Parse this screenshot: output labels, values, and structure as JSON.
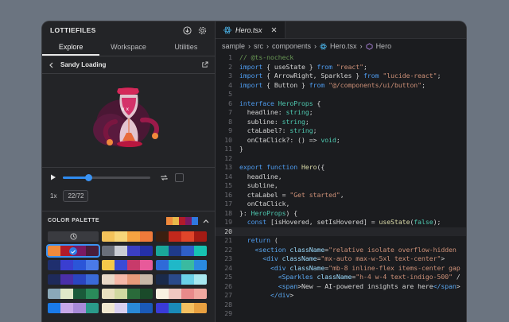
{
  "left_panel": {
    "title": "LOTTIEFILES",
    "tabs": [
      {
        "label": "Explore"
      },
      {
        "label": "Workspace"
      },
      {
        "label": "Utilities"
      }
    ],
    "animation_name": "Sandy Loading",
    "player": {
      "progress": 0.29,
      "speed": "1x",
      "frame": "22/72"
    },
    "palette": {
      "title": "COLOR PALETTE",
      "current": [
        "#f08a3c",
        "#e8b94a",
        "#b11b2a",
        "#7a1a63",
        "#2f78e0"
      ]
    }
  },
  "editor": {
    "tab": {
      "file": "Hero.tsx"
    },
    "breadcrumb": [
      "sample",
      "src",
      "components",
      "Hero.tsx",
      "Hero"
    ],
    "current_line": 20,
    "lines": [
      {
        "n": "1",
        "t": "// @ts-nocheck"
      },
      {
        "n": "2",
        "t": "import { useState } from \"react\";"
      },
      {
        "n": "3",
        "t": "import { ArrowRight, Sparkles } from \"lucide-react\";"
      },
      {
        "n": "4",
        "t": "import { Button } from \"@/components/ui/button\";"
      },
      {
        "n": "5",
        "t": ""
      },
      {
        "n": "6",
        "t": "interface HeroProps {"
      },
      {
        "n": "7",
        "t": "  headline: string;"
      },
      {
        "n": "8",
        "t": "  subline: string;"
      },
      {
        "n": "9",
        "t": "  ctaLabel?: string;"
      },
      {
        "n": "10",
        "t": "  onCtaClick?: () => void;"
      },
      {
        "n": "11",
        "t": "}"
      },
      {
        "n": "12",
        "t": ""
      },
      {
        "n": "13",
        "t": "export function Hero({"
      },
      {
        "n": "14",
        "t": "  headline,"
      },
      {
        "n": "15",
        "t": "  subline,"
      },
      {
        "n": "16",
        "t": "  ctaLabel = \"Get started\","
      },
      {
        "n": "17",
        "t": "  onCtaClick,"
      },
      {
        "n": "18",
        "t": "}: HeroProps) {"
      },
      {
        "n": "19",
        "t": "  const [isHovered, setIsHovered] = useState(false);"
      },
      {
        "n": "20",
        "t": ""
      },
      {
        "n": "21",
        "t": "  return ("
      },
      {
        "n": "22",
        "t": "    <section className=\"relative isolate overflow-hidden"
      },
      {
        "n": "23",
        "t": "      <div className=\"mx-auto max-w-5xl text-center\">"
      },
      {
        "n": "24",
        "t": "        <div className=\"mb-8 inline-flex items-center gap"
      },
      {
        "n": "25",
        "t": "          <Sparkles className=\"h-4 w-4 text-indigo-500\" /"
      },
      {
        "n": "26",
        "t": "          <span>New — AI-powered insights are here</span>"
      },
      {
        "n": "27",
        "t": "        </div>"
      },
      {
        "n": "28",
        "t": ""
      },
      {
        "n": "29",
        "t": ""
      }
    ]
  }
}
